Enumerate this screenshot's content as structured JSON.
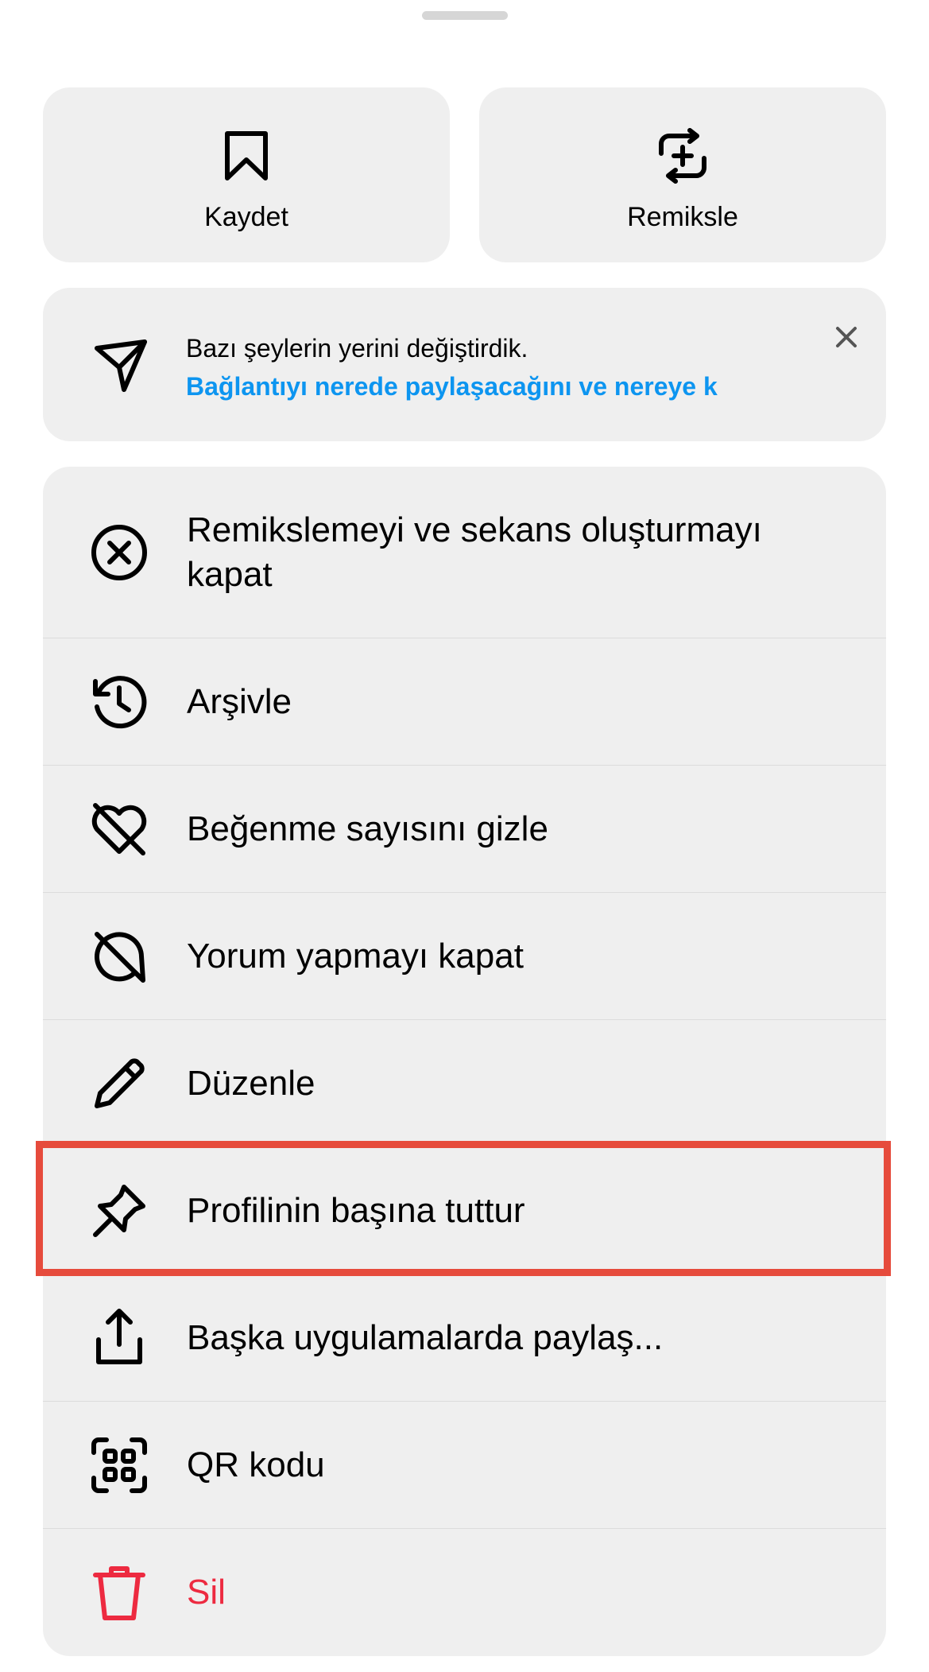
{
  "quick_actions": [
    {
      "label": "Kaydet",
      "icon": "bookmark-icon"
    },
    {
      "label": "Remiksle",
      "icon": "remix-icon"
    }
  ],
  "notice": {
    "title": "Bazı şeylerin yerini değiştirdik.",
    "link": "Bağlantıyı nerede paylaşacağını ve nereye k",
    "icon": "send-icon",
    "close_icon": "close-icon"
  },
  "menu": [
    {
      "label": "Remikslemeyi ve sekans oluşturmayı kapat",
      "icon": "circle-x-icon"
    },
    {
      "label": "Arşivle",
      "icon": "archive-history-icon"
    },
    {
      "label": "Beğenme sayısını gizle",
      "icon": "heart-off-icon"
    },
    {
      "label": "Yorum yapmayı kapat",
      "icon": "comment-off-icon"
    },
    {
      "label": "Düzenle",
      "icon": "pencil-icon"
    },
    {
      "label": "Profilinin başına tuttur",
      "icon": "pin-icon"
    },
    {
      "label": "Başka uygulamalarda paylaş...",
      "icon": "share-icon"
    },
    {
      "label": "QR kodu",
      "icon": "qr-code-icon"
    },
    {
      "label": "Sil",
      "icon": "trash-icon"
    }
  ],
  "colors": {
    "link": "#0d95f0",
    "danger": "#ed2a40",
    "highlight": "#e64b3c",
    "card_bg": "#efefef"
  }
}
